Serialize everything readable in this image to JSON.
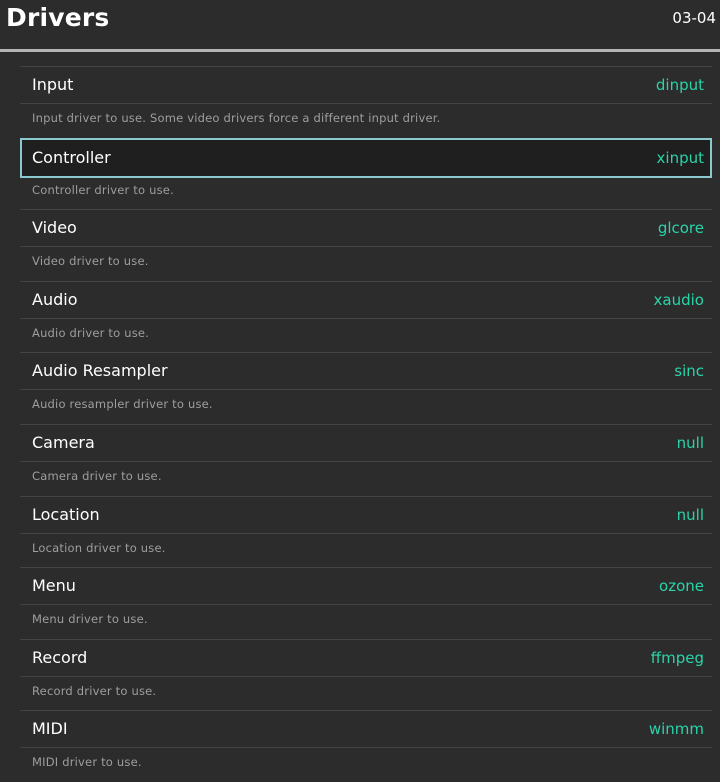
{
  "header": {
    "title": "Drivers",
    "clock": "03-04"
  },
  "colors": {
    "background": "#2c2c2c",
    "value_accent": "#29d4a9",
    "selection_border": "#8cc9cf",
    "description_text": "#9e9e9e"
  },
  "selected_index": 1,
  "items": [
    {
      "label": "Input",
      "value": "dinput",
      "description": "Input driver to use. Some video drivers force a different input driver."
    },
    {
      "label": "Controller",
      "value": "xinput",
      "description": "Controller driver to use."
    },
    {
      "label": "Video",
      "value": "glcore",
      "description": "Video driver to use."
    },
    {
      "label": "Audio",
      "value": "xaudio",
      "description": "Audio driver to use."
    },
    {
      "label": "Audio Resampler",
      "value": "sinc",
      "description": "Audio resampler driver to use."
    },
    {
      "label": "Camera",
      "value": "null",
      "description": "Camera driver to use."
    },
    {
      "label": "Location",
      "value": "null",
      "description": "Location driver to use."
    },
    {
      "label": "Menu",
      "value": "ozone",
      "description": "Menu driver to use."
    },
    {
      "label": "Record",
      "value": "ffmpeg",
      "description": "Record driver to use."
    },
    {
      "label": "MIDI",
      "value": "winmm",
      "description": "MIDI driver to use."
    }
  ]
}
